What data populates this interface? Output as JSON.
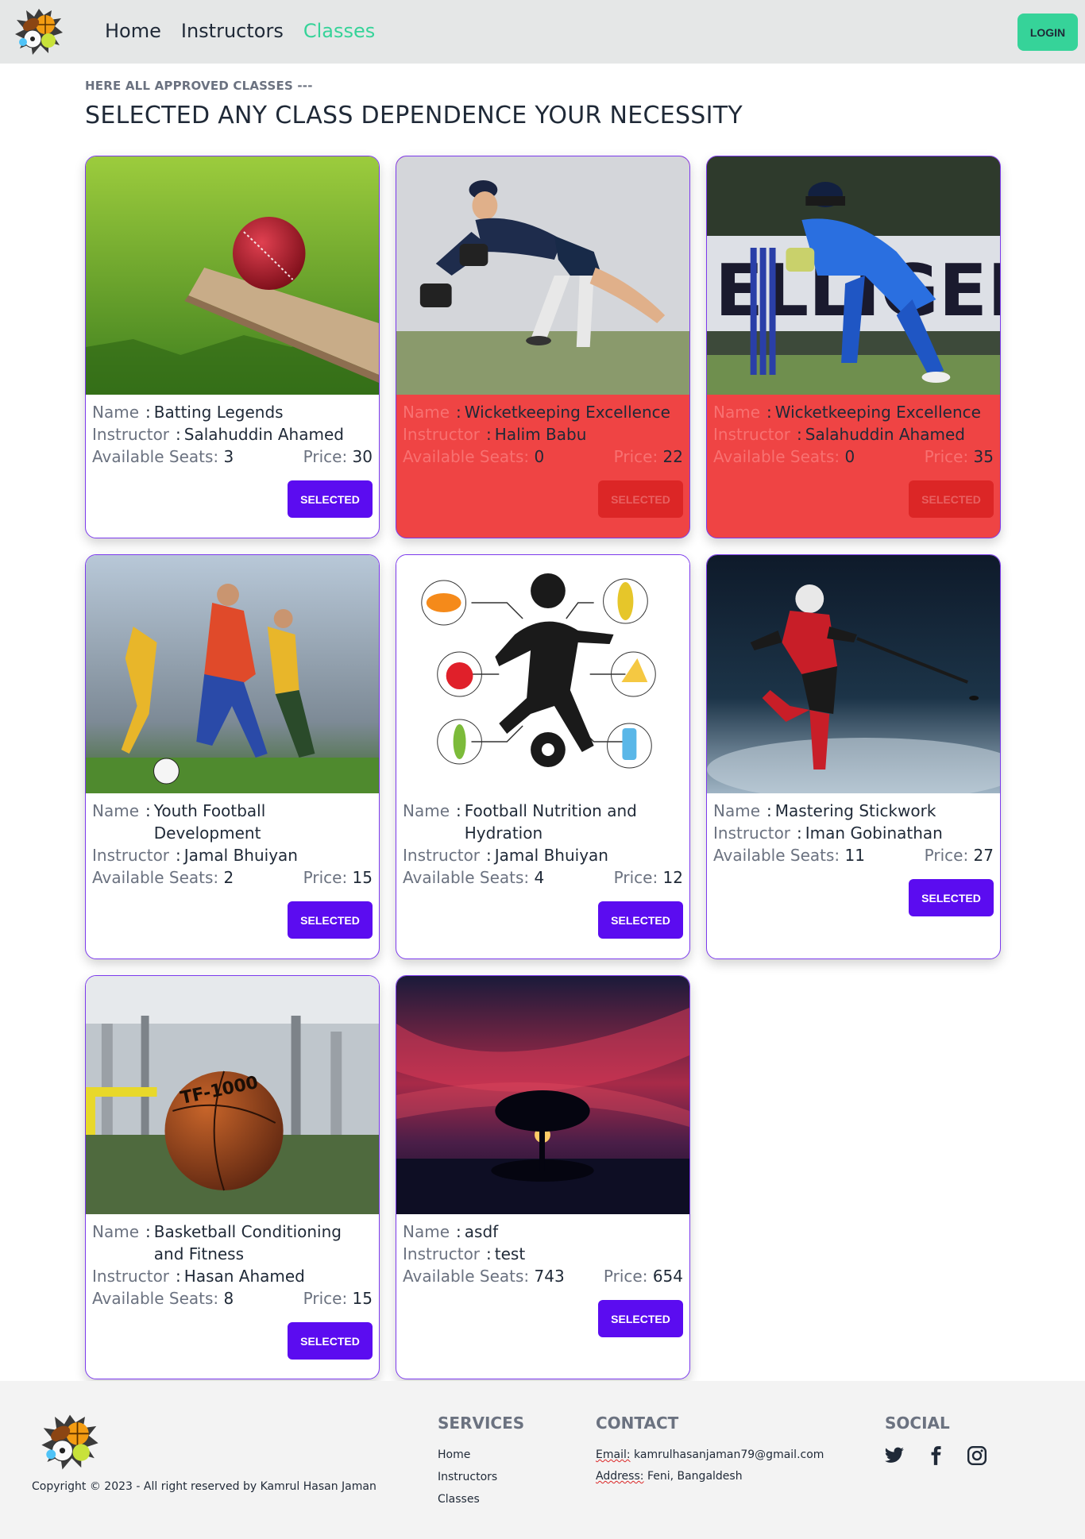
{
  "nav": {
    "links": [
      "Home",
      "Instructors",
      "Classes"
    ],
    "login": "LOGIN"
  },
  "header": {
    "subheading": "HERE ALL APPROVED CLASSES ---",
    "heading": "SELECTED ANY CLASS DEPENDENCE YOUR NECESSITY"
  },
  "labels": {
    "name": "Name",
    "instructor": "Instructor",
    "seats": "Available Seats:",
    "price": "Price:",
    "colon": ":",
    "button": "SELECTED"
  },
  "classes": [
    {
      "name": "Batting Legends",
      "instructor": "Salahuddin Ahamed",
      "seats": "3",
      "price": "30",
      "full": false,
      "image": "cricket-ball-on-bat"
    },
    {
      "name": "Wicketkeeping Excellence",
      "instructor": "Halim Babu",
      "seats": "0",
      "price": "22",
      "full": true,
      "image": "wicketkeeper-diving"
    },
    {
      "name": "Wicketkeeping Excellence",
      "instructor": "Salahuddin Ahamed",
      "seats": "0",
      "price": "35",
      "full": true,
      "image": "wicketkeeper-blue-kit"
    },
    {
      "name": "Youth Football Development",
      "instructor": "Jamal Bhuiyan",
      "seats": "2",
      "price": "15",
      "full": false,
      "image": "football-players"
    },
    {
      "name": "Football Nutrition and Hydration",
      "instructor": "Jamal Bhuiyan",
      "seats": "4",
      "price": "12",
      "full": false,
      "image": "nutrition-diagram"
    },
    {
      "name": "Mastering Stickwork",
      "instructor": "Iman Gobinathan",
      "seats": "11",
      "price": "27",
      "full": false,
      "image": "ice-hockey-player"
    },
    {
      "name": "Basketball Conditioning and Fitness",
      "instructor": "Hasan Ahamed",
      "seats": "8",
      "price": "15",
      "full": false,
      "image": "basketball-in-gym"
    },
    {
      "name": "asdf",
      "instructor": "test",
      "seats": "743",
      "price": "654",
      "full": false,
      "image": "tree-sunset"
    }
  ],
  "footer": {
    "copyright": "Copyright © 2023 - All right reserved by Kamrul Hasan Jaman",
    "services_title": "SERVICES",
    "services": [
      "Home",
      "Instructors",
      "Classes"
    ],
    "contact_title": "CONTACT",
    "email_label": "Email:",
    "email": "kamrulhasanjaman79@gmail.com",
    "address_label": "Address:",
    "address": "Feni, Bangaldesh",
    "social_title": "SOCIAL",
    "social_icons": [
      "twitter-icon",
      "facebook-icon",
      "instagram-icon"
    ]
  },
  "colors": {
    "accent": "#36d399",
    "button": "#5b0cf0",
    "full": "#ef4444",
    "border": "#7c3aed"
  }
}
